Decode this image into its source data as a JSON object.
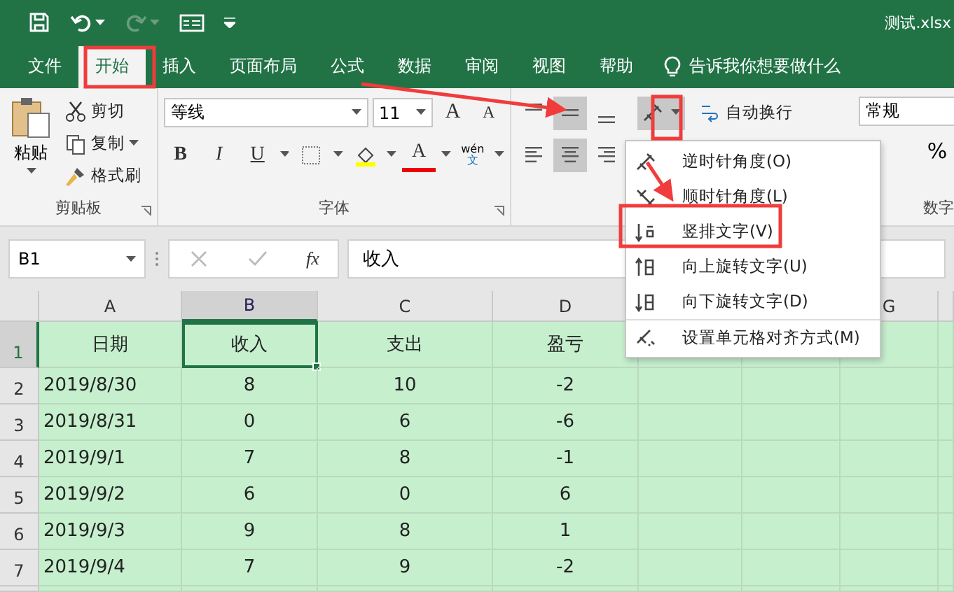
{
  "title_bar": {
    "title": "测试.xlsx",
    "redo_disabled": true
  },
  "tabs": [
    {
      "label": "文件",
      "selected": false
    },
    {
      "label": "开始",
      "selected": true
    },
    {
      "label": "插入",
      "selected": false
    },
    {
      "label": "页面布局",
      "selected": false
    },
    {
      "label": "公式",
      "selected": false
    },
    {
      "label": "数据",
      "selected": false
    },
    {
      "label": "审阅",
      "selected": false
    },
    {
      "label": "视图",
      "selected": false
    },
    {
      "label": "帮助",
      "selected": false
    }
  ],
  "tell_me": "告诉我你想要做什么",
  "ribbon": {
    "clipboard": {
      "paste": "粘贴",
      "cut": "剪切",
      "copy": "复制",
      "format_painter": "格式刷",
      "label": "剪贴板"
    },
    "font": {
      "name": "等线",
      "size": "11",
      "grow": "A",
      "shrink": "A",
      "styles": [
        {
          "label": "B",
          "kind": "bold"
        },
        {
          "label": "I",
          "kind": "italic"
        },
        {
          "label": "U",
          "kind": "underline"
        }
      ],
      "font_color": "A",
      "phonetic": [
        "wén",
        "文"
      ],
      "label": "字体"
    },
    "alignment": {
      "vertical": [
        {
          "selected": false
        },
        {
          "selected": true
        },
        {
          "selected": false
        }
      ],
      "horizontal": [
        {
          "selected": false
        },
        {
          "selected": true
        },
        {
          "selected": false
        }
      ],
      "orientation_active": true,
      "wrap": "自动换行"
    },
    "number": {
      "format": "常规",
      "percent": "%",
      "label": "数字"
    }
  },
  "formula_bar": {
    "name_box": "B1",
    "fx": "fx",
    "value": "收入"
  },
  "orientation_menu": {
    "items": [
      {
        "label": "逆时针角度(O)",
        "kind": "ccw"
      },
      {
        "label": "顺时针角度(L)",
        "kind": "cw"
      },
      {
        "label": "竖排文字(V)",
        "kind": "vertical"
      },
      {
        "label": "向上旋转文字(U)",
        "kind": "up"
      },
      {
        "label": "向下旋转文字(D)",
        "kind": "down"
      },
      {
        "label": "设置单元格对齐方式(M)",
        "kind": "format",
        "separated": true
      }
    ]
  },
  "sheet": {
    "columns": [
      {
        "label": "A",
        "selected": false
      },
      {
        "label": "B",
        "selected": true
      },
      {
        "label": "C",
        "selected": false
      },
      {
        "label": "D",
        "selected": false
      },
      {
        "label": "G",
        "selected": false
      }
    ],
    "rows": [
      {
        "header": "1",
        "selected": true,
        "cells": [
          {
            "text": "日期",
            "selected": false
          },
          {
            "text": "收入",
            "selected": true
          },
          {
            "text": "支出",
            "selected": false
          },
          {
            "text": "盈亏",
            "selected": false
          }
        ]
      },
      {
        "header": "2",
        "selected": false,
        "cells": [
          {
            "text": "2019/8/30",
            "selected": false
          },
          {
            "text": "8",
            "selected": false
          },
          {
            "text": "10",
            "selected": false
          },
          {
            "text": "-2",
            "selected": false
          }
        ]
      },
      {
        "header": "3",
        "selected": false,
        "cells": [
          {
            "text": "2019/8/31",
            "selected": false
          },
          {
            "text": "0",
            "selected": false
          },
          {
            "text": "6",
            "selected": false
          },
          {
            "text": "-6",
            "selected": false
          }
        ]
      },
      {
        "header": "4",
        "selected": false,
        "cells": [
          {
            "text": "2019/9/1",
            "selected": false
          },
          {
            "text": "7",
            "selected": false
          },
          {
            "text": "8",
            "selected": false
          },
          {
            "text": "-1",
            "selected": false
          }
        ]
      },
      {
        "header": "5",
        "selected": false,
        "cells": [
          {
            "text": "2019/9/2",
            "selected": false
          },
          {
            "text": "6",
            "selected": false
          },
          {
            "text": "0",
            "selected": false
          },
          {
            "text": "6",
            "selected": false
          }
        ]
      },
      {
        "header": "6",
        "selected": false,
        "cells": [
          {
            "text": "2019/9/3",
            "selected": false
          },
          {
            "text": "9",
            "selected": false
          },
          {
            "text": "8",
            "selected": false
          },
          {
            "text": "1",
            "selected": false
          }
        ]
      },
      {
        "header": "7",
        "selected": false,
        "cells": [
          {
            "text": "2019/9/4",
            "selected": false
          },
          {
            "text": "7",
            "selected": false
          },
          {
            "text": "9",
            "selected": false
          },
          {
            "text": "-2",
            "selected": false
          }
        ]
      }
    ]
  }
}
